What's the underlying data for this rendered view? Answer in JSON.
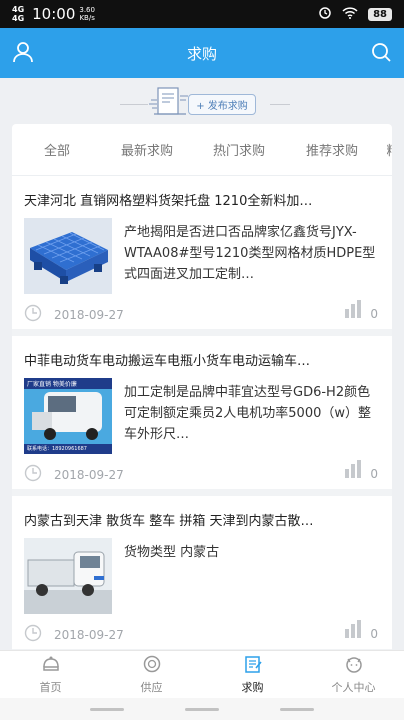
{
  "status": {
    "signal1": "4G",
    "signal2": "4G",
    "time": "10:00",
    "speed_value": "3.60",
    "speed_unit": "KB/s",
    "battery": "88"
  },
  "header": {
    "title": "求购",
    "left_icon": "user-icon",
    "right_icon": "search-icon"
  },
  "banner": {
    "publish_label": "+ 发布求购"
  },
  "tabs": [
    "全部",
    "最新求购",
    "热门求购",
    "推荐求购",
    "精"
  ],
  "items": [
    {
      "title": "天津河北 直销网格塑料货架托盘 1210全新料加…",
      "desc": "产地揭阳是否进口否品牌家亿鑫货号JYX-WTAA08#型号1210类型网格材质HDPE型式四面进叉加工定制…",
      "date": "2018-09-27",
      "views": "0"
    },
    {
      "title": "中菲电动货车电动搬运车电瓶小货车电动运输车…",
      "desc": "加工定制是品牌中菲宜达型号GD6-H2颜色可定制额定乘员2人电机功率5000（w）整车外形尺…",
      "date": "2018-09-27",
      "views": "0",
      "thumb_text_top": "厂家直销  物美价廉",
      "thumb_text_bottom": "联系电话：18920961687"
    },
    {
      "title": "内蒙古到天津 散货车 整车 拼箱 天津到内蒙古散…",
      "desc": "货物类型 内蒙古",
      "date": "2018-09-27",
      "views": "0"
    }
  ],
  "bottom_nav": [
    {
      "label": "首页",
      "icon": "home-icon"
    },
    {
      "label": "供应",
      "icon": "supply-icon"
    },
    {
      "label": "求购",
      "icon": "purchase-icon"
    },
    {
      "label": "个人中心",
      "icon": "profile-icon"
    }
  ],
  "colors": {
    "brand": "#2da0ea",
    "status_bar": "#101010"
  }
}
